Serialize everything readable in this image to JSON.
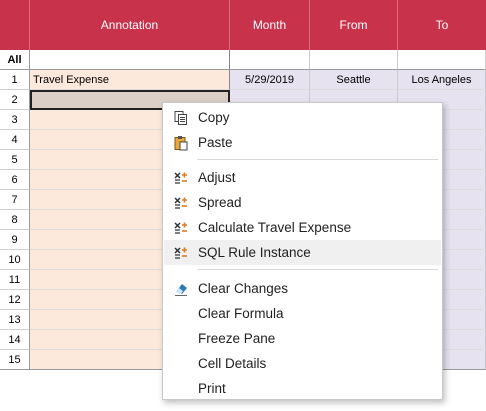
{
  "columns": {
    "annotation": "Annotation",
    "month": "Month",
    "from": "From",
    "to": "To"
  },
  "all_label": "All",
  "rows": [
    {
      "num": "1",
      "annotation": "Travel Expense",
      "month": "5/29/2019",
      "from": "Seattle",
      "to": "Los Angeles"
    },
    {
      "num": "2",
      "annotation": "",
      "month": "",
      "from": "",
      "to": ""
    },
    {
      "num": "3",
      "annotation": "",
      "month": "",
      "from": "",
      "to": ""
    },
    {
      "num": "4",
      "annotation": "",
      "month": "",
      "from": "",
      "to": ""
    },
    {
      "num": "5",
      "annotation": "",
      "month": "",
      "from": "",
      "to": ""
    },
    {
      "num": "6",
      "annotation": "",
      "month": "",
      "from": "",
      "to": ""
    },
    {
      "num": "7",
      "annotation": "",
      "month": "",
      "from": "",
      "to": ""
    },
    {
      "num": "8",
      "annotation": "",
      "month": "",
      "from": "",
      "to": ""
    },
    {
      "num": "9",
      "annotation": "",
      "month": "",
      "from": "",
      "to": ""
    },
    {
      "num": "10",
      "annotation": "",
      "month": "",
      "from": "",
      "to": ""
    },
    {
      "num": "11",
      "annotation": "",
      "month": "",
      "from": "",
      "to": ""
    },
    {
      "num": "12",
      "annotation": "",
      "month": "",
      "from": "",
      "to": ""
    },
    {
      "num": "13",
      "annotation": "",
      "month": "",
      "from": "",
      "to": ""
    },
    {
      "num": "14",
      "annotation": "",
      "month": "",
      "from": "",
      "to": ""
    },
    {
      "num": "15",
      "annotation": "",
      "month": "",
      "from": "",
      "to": ""
    }
  ],
  "context_menu": {
    "copy": "Copy",
    "paste": "Paste",
    "adjust": "Adjust",
    "spread": "Spread",
    "calculate": "Calculate Travel Expense",
    "sql_rule": "SQL Rule Instance",
    "clear_changes": "Clear Changes",
    "clear_formula": "Clear Formula",
    "freeze_pane": "Freeze Pane",
    "cell_details": "Cell Details",
    "print": "Print"
  },
  "colors": {
    "header": "#c8324a",
    "annotation_cell": "#fde9dc",
    "data_cell": "#e6e2f0",
    "selected_cell": "#dccfc6",
    "icon_orange": "#e07b1e",
    "icon_blue": "#2a7ab8"
  },
  "icons": {
    "copy": "copy-icon",
    "paste": "paste-icon",
    "adjust": "adjust-icon",
    "spread": "spread-icon",
    "calculate": "calculate-icon",
    "sql_rule": "sql-rule-icon",
    "clear_changes": "eraser-icon"
  }
}
